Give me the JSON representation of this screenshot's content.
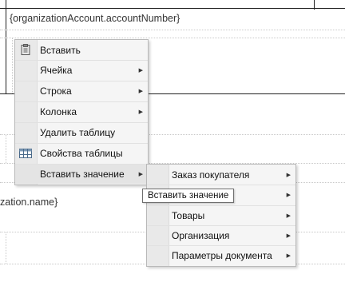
{
  "document": {
    "field_account_number": "{organizationAccount.accountNumber}",
    "field_org_name": "zation.name}"
  },
  "context_menu": {
    "items": [
      {
        "label": "Вставить",
        "icon": "paste-icon",
        "submenu": false
      },
      {
        "label": "Ячейка",
        "icon": "",
        "submenu": true
      },
      {
        "label": "Строка",
        "icon": "",
        "submenu": true
      },
      {
        "label": "Колонка",
        "icon": "",
        "submenu": true
      },
      {
        "label": "Удалить таблицу",
        "icon": "",
        "submenu": false
      },
      {
        "label": "Свойства таблицы",
        "icon": "table-icon",
        "submenu": false
      },
      {
        "label": "Вставить значение",
        "icon": "",
        "submenu": true,
        "highlighted": true
      }
    ]
  },
  "submenu": {
    "items": [
      {
        "label": "Заказ покупателя",
        "submenu": true
      },
      {
        "label": "",
        "submenu": true
      },
      {
        "label": "Товары",
        "submenu": true
      },
      {
        "label": "Организация",
        "submenu": true
      },
      {
        "label": "Параметры документа",
        "submenu": true
      }
    ]
  },
  "tooltip": {
    "text": "Вставить значение"
  },
  "colors": {
    "menu_bg": "#f5f5f5",
    "gutter_bg": "#e9e9e9",
    "highlight_bg": "#e4e4e4",
    "border": "#b9b9b9"
  }
}
